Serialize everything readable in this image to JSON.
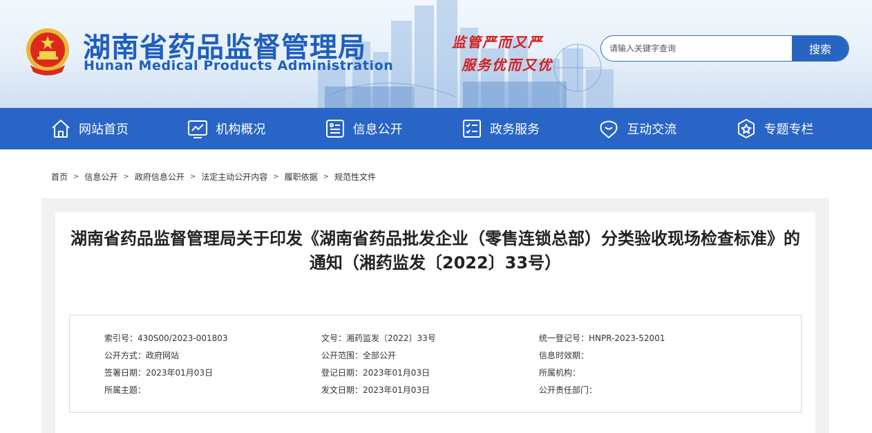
{
  "header": {
    "title": "湖南省药品监督管理局",
    "subtitle": "Hunan Medical Products Administration",
    "slogan_1": "监管严而又严",
    "slogan_2": "服务优而又优",
    "search_placeholder": "请输入关键字查询",
    "search_button": "搜索"
  },
  "nav": {
    "items": [
      {
        "label": "网站首页",
        "icon": "home-icon"
      },
      {
        "label": "机构概况",
        "icon": "chart-monitor-icon"
      },
      {
        "label": "信息公开",
        "icon": "info-board-icon"
      },
      {
        "label": "政务服务",
        "icon": "checklist-icon"
      },
      {
        "label": "互动交流",
        "icon": "chat-bubbles-icon"
      },
      {
        "label": "专题专栏",
        "icon": "star-badge-icon"
      }
    ]
  },
  "breadcrumb": [
    "首页",
    "信息公开",
    "政府信息公开",
    "法定主动公开内容",
    "履职依据",
    "规范性文件"
  ],
  "article": {
    "title": "湖南省药品监督管理局关于印发《湖南省药品批发企业（零售连锁总部）分类验收现场检查标准》的通知（湘药监发〔2022〕33号）"
  },
  "meta": {
    "rows": [
      [
        "索引号：430S00/2023-001803",
        "文号：湘药监发〔2022〕33号",
        "统一登记号：HNPR-2023-52001"
      ],
      [
        "公开方式：政府网站",
        "公开范围：全部公开",
        "信息时效期："
      ],
      [
        "签署日期：2023年01月03日",
        "登记日期：2023年01月03日",
        "所属机构："
      ],
      [
        "所属主题：",
        "发文日期：2023年01月03日",
        "公开责任部门："
      ]
    ]
  },
  "colors": {
    "brand_blue": "#2865c6",
    "title_blue": "#1e5fbd",
    "slogan_red": "#d41d1d"
  }
}
